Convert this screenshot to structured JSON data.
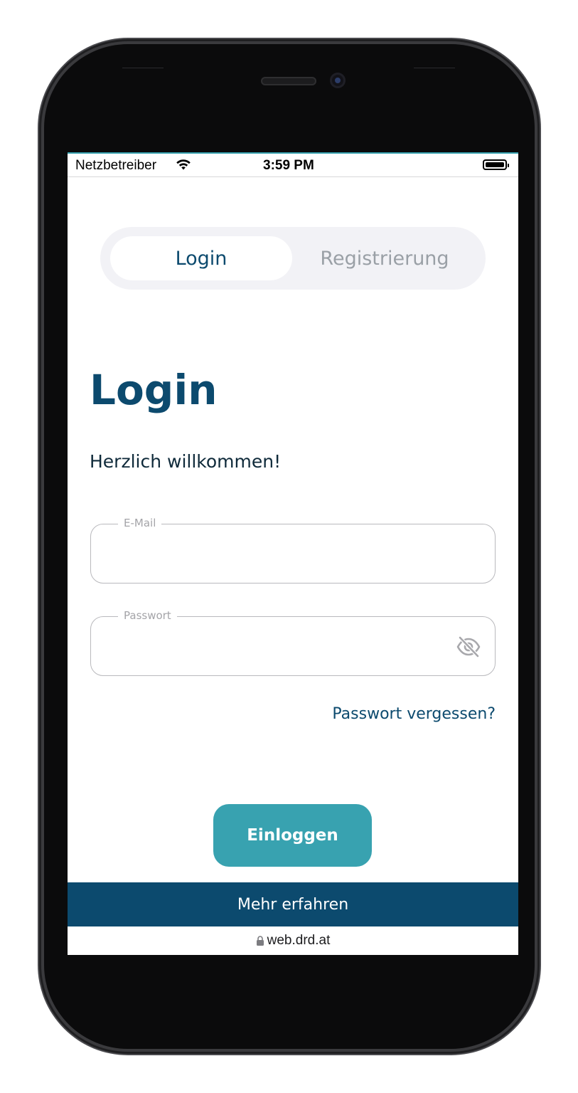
{
  "status_bar": {
    "carrier": "Netzbetreiber",
    "time": "3:59 PM",
    "wifi_icon": "wifi-icon",
    "battery_icon": "battery-icon"
  },
  "tabs": {
    "login": "Login",
    "register": "Registrierung",
    "active": "login"
  },
  "main": {
    "title": "Login",
    "welcome": "Herzlich willkommen!"
  },
  "form": {
    "email": {
      "label": "E-Mail",
      "value": "",
      "placeholder": ""
    },
    "password": {
      "label": "Passwort",
      "value": "",
      "placeholder": "",
      "toggle_icon": "eye-off-icon"
    },
    "forgot_link": "Passwort vergessen?",
    "submit_label": "Einloggen"
  },
  "footer": {
    "more_label": "Mehr erfahren",
    "url": "web.drd.at",
    "lock_icon": "lock-icon"
  },
  "colors": {
    "primary": "#0c4a6e",
    "accent": "#38a2b0",
    "tab_track": "#f2f2f6",
    "inactive_text": "#9aa0a6",
    "field_border": "#b9b9bd"
  }
}
